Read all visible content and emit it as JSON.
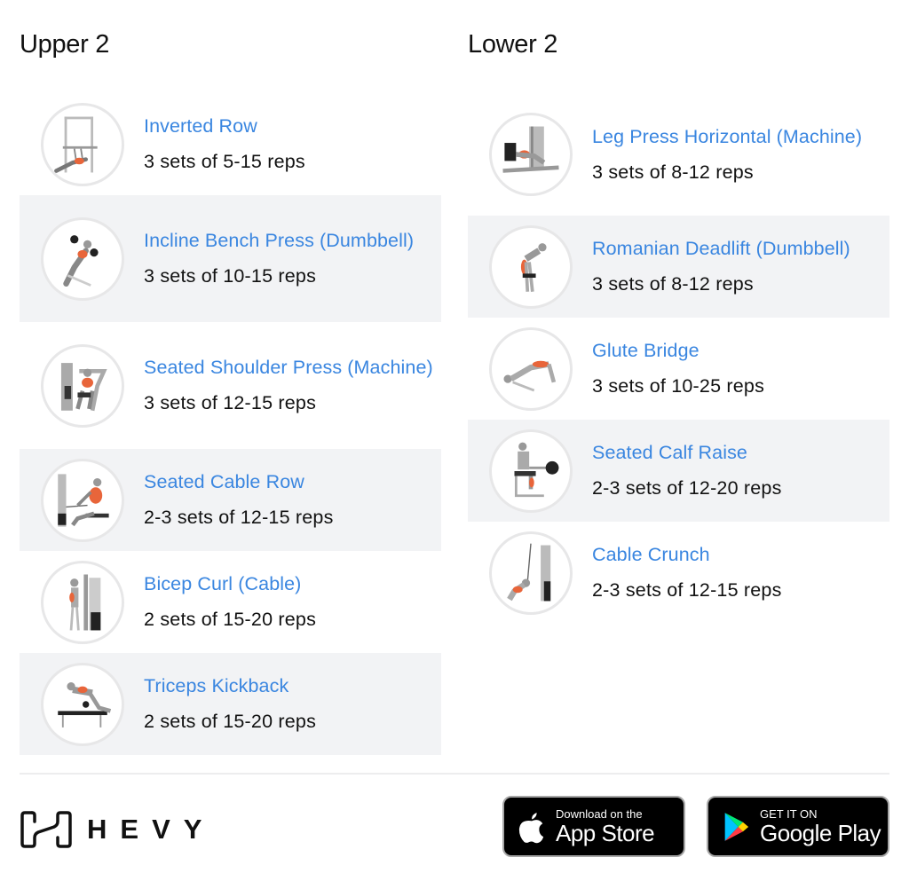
{
  "routines": [
    {
      "title": "Upper 2",
      "exercises": [
        {
          "name": "Inverted Row",
          "sets": "3 sets of 5-15 reps",
          "icon": "inverted-row-illustration"
        },
        {
          "name": "Incline Bench Press (Dumbbell)",
          "sets": "3 sets of 10-15 reps",
          "icon": "incline-dumbbell-press-illustration"
        },
        {
          "name": "Seated Shoulder Press (Machine)",
          "sets": "3 sets of 12-15 reps",
          "icon": "shoulder-press-machine-illustration"
        },
        {
          "name": "Seated Cable Row",
          "sets": "2-3 sets of 12-15 reps",
          "icon": "seated-cable-row-illustration"
        },
        {
          "name": "Bicep Curl (Cable)",
          "sets": "2 sets of 15-20 reps",
          "icon": "cable-bicep-curl-illustration"
        },
        {
          "name": "Triceps Kickback",
          "sets": "2 sets of 15-20 reps",
          "icon": "triceps-kickback-illustration"
        }
      ]
    },
    {
      "title": "Lower 2",
      "exercises": [
        {
          "name": "Leg Press Horizontal (Machine)",
          "sets": "3 sets of 8-12 reps",
          "icon": "leg-press-illustration"
        },
        {
          "name": "Romanian Deadlift (Dumbbell)",
          "sets": "3 sets of 8-12 reps",
          "icon": "romanian-deadlift-illustration"
        },
        {
          "name": "Glute Bridge",
          "sets": "3 sets of 10-25 reps",
          "icon": "glute-bridge-illustration"
        },
        {
          "name": "Seated Calf Raise",
          "sets": "2-3 sets of 12-20 reps",
          "icon": "seated-calf-raise-illustration"
        },
        {
          "name": "Cable Crunch",
          "sets": "2-3 sets of 12-15 reps",
          "icon": "cable-crunch-illustration"
        }
      ]
    }
  ],
  "footer": {
    "brand": "HEVY",
    "app_store": {
      "small": "Download on the",
      "big": "App Store"
    },
    "google_play": {
      "small": "GET IT ON",
      "big": "Google Play"
    }
  },
  "colors": {
    "link": "#3a86e0",
    "row_shade": "#f2f3f5",
    "muscle_highlight": "#e8653a"
  }
}
